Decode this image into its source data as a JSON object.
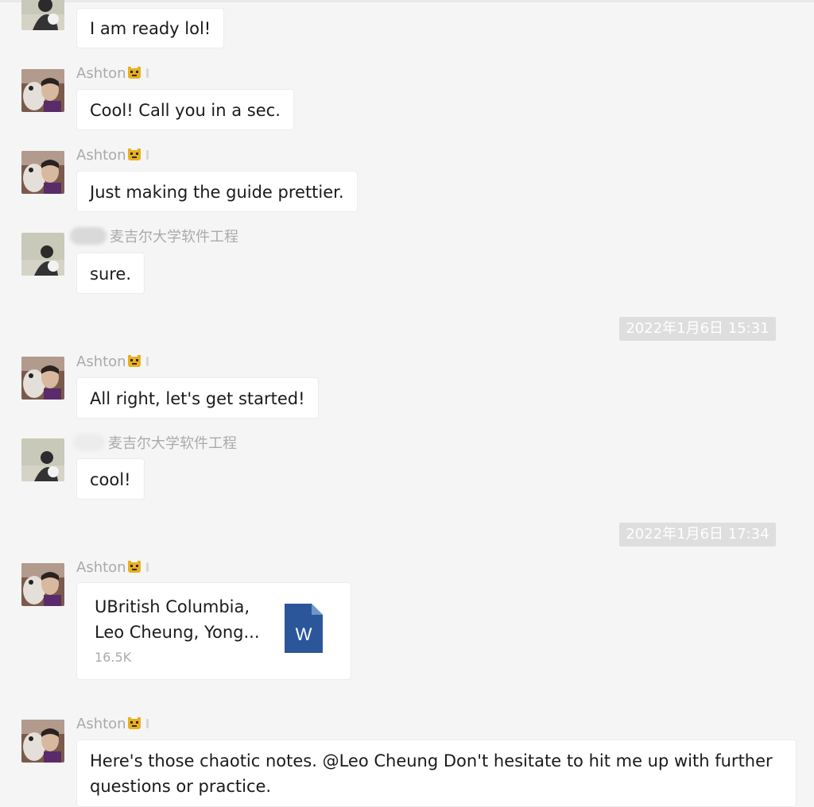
{
  "sender_suffix": "麦吉尔大学软件工程",
  "messages": [
    {
      "sender": "",
      "text": "I am ready lol!"
    },
    {
      "sender": "Ashton",
      "text": "Cool! Call you in a sec."
    },
    {
      "sender": "Ashton",
      "text": "Just making the guide prettier."
    },
    {
      "sender": "麦吉尔大学软件工程",
      "text": "sure."
    },
    {
      "sender": "Ashton",
      "text": "All right, let's get started!"
    },
    {
      "sender": "麦吉尔大学软件工程",
      "text": "cool!"
    },
    {
      "sender": "Ashton",
      "file": {
        "name_line1": "UBritish Columbia,",
        "name_line2": "Leo Cheung, Yong...",
        "size": "16.5K",
        "type_icon": "word-doc-icon",
        "type_letter": "W"
      }
    },
    {
      "sender": "Ashton",
      "text": "Here's those chaotic notes. @Leo Cheung Don't hesitate to hit me up with further questions or practice."
    }
  ],
  "timestamps": [
    "2022年1月6日 15:31",
    "2022年1月6日 17:34"
  ],
  "colors": {
    "background": "#f5f5f5",
    "bubble": "#ffffff",
    "sender_text": "#aaaaaa",
    "timestamp_bg": "#dedede",
    "word_icon": "#2b579a"
  }
}
